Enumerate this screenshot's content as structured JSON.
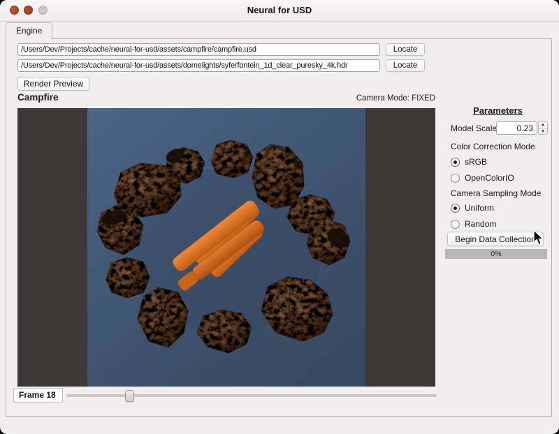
{
  "window": {
    "title": "Neural for USD",
    "controls": [
      "close-button",
      "minimize-button",
      "zoom-button"
    ]
  },
  "tab": {
    "label": "Engine"
  },
  "paths": {
    "usd": {
      "value": "/Users/Dev/Projects/cache/neural-for-usd/assets/campfire/campfire.usd",
      "locate_label": "Locate"
    },
    "hdr": {
      "value": "/Users/Dev/Projects/cache/neural-for-usd/assets/domelights/syferfontein_1d_clear_puresky_4k.hdr",
      "locate_label": "Locate"
    }
  },
  "actions": {
    "render_preview_label": "Render Preview"
  },
  "preview": {
    "title": "Campfire",
    "camera_mode": "Camera Mode: FIXED",
    "scene": {
      "letterbox_color": "#3a3938",
      "background_top": "#4b6582",
      "background_bottom": "#36495e",
      "rock_color": "#8a5c3e",
      "log_color": "#dd7124"
    }
  },
  "parameters": {
    "heading": "Parameters",
    "model_scale": {
      "label": "Model Scale",
      "value": "0.23"
    },
    "color_correction": {
      "label": "Color Correction Mode",
      "options": [
        {
          "label": "sRGB",
          "selected": true
        },
        {
          "label": "OpenColorIO",
          "selected": false
        }
      ]
    },
    "camera_sampling": {
      "label": "Camera Sampling Mode",
      "options": [
        {
          "label": "Uniform",
          "selected": true
        },
        {
          "label": "Random",
          "selected": false
        }
      ]
    },
    "begin_button_label": "Begin Data Collection",
    "progress": {
      "label": "0%",
      "percent": 0
    }
  },
  "frame_control": {
    "label": "Frame 18",
    "slider_percent": 17
  }
}
